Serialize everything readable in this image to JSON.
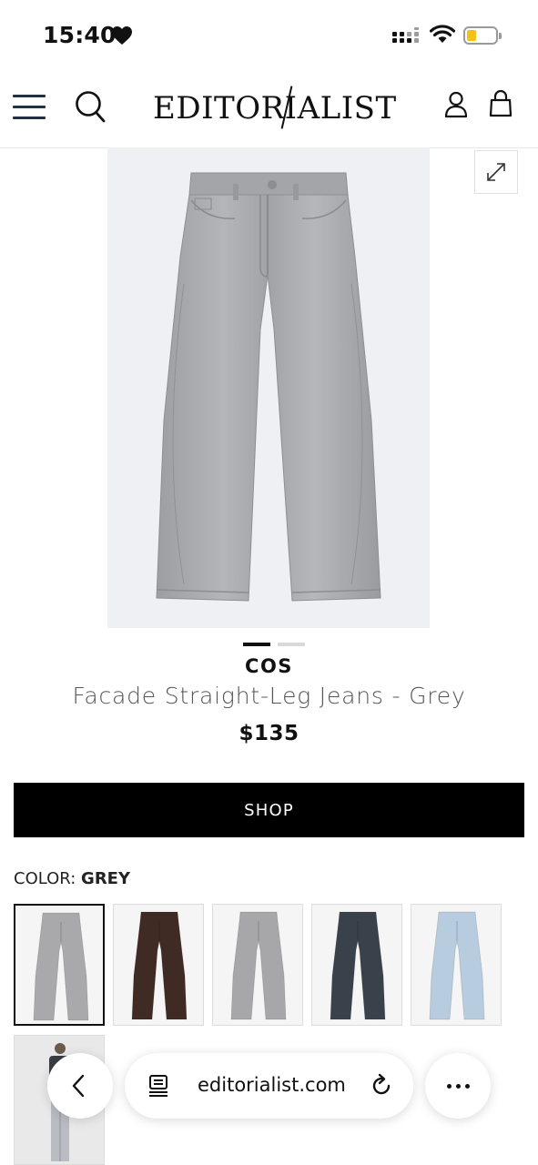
{
  "status_bar": {
    "time": "15:40"
  },
  "header": {
    "logo": "EDITORIALIST"
  },
  "product": {
    "brand": "COS",
    "name": "Facade Straight-Leg Jeans - Grey",
    "price": "$135",
    "image_count": 2,
    "active_image": 1
  },
  "actions": {
    "shop_label": "SHOP"
  },
  "color": {
    "label": "COLOR:",
    "selected": "GREY",
    "swatches": [
      {
        "name": "grey",
        "color": "#a9a9ab"
      },
      {
        "name": "brown",
        "color": "#3f2a24"
      },
      {
        "name": "grey-alt",
        "color": "#a7a7a9"
      },
      {
        "name": "black",
        "color": "#39424a"
      },
      {
        "name": "light-blue",
        "color": "#b7ccde"
      },
      {
        "name": "model",
        "color": "#e9e9ea"
      }
    ]
  },
  "browser": {
    "url": "editorialist.com"
  },
  "colors": {
    "accent": "#000000",
    "battery": "#f2c21a",
    "jeans_grey": "#a9a9ab"
  }
}
